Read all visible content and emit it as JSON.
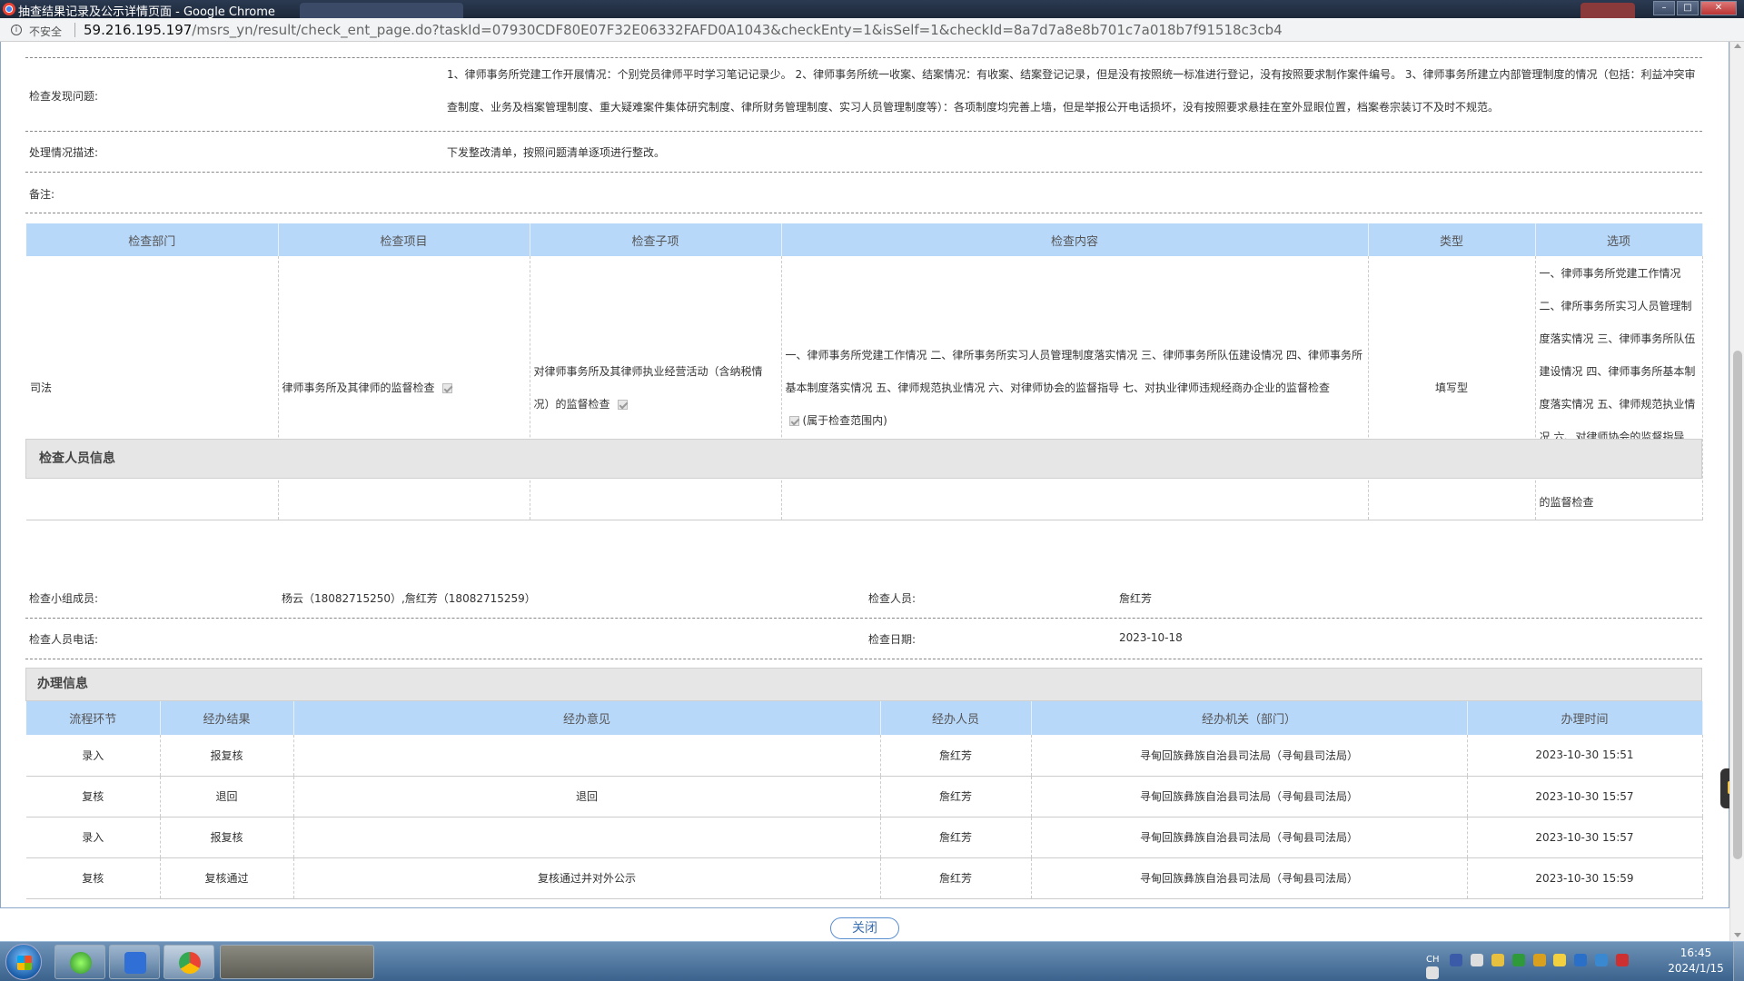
{
  "window": {
    "title": "抽查结果记录及公示详情页面 - Google Chrome"
  },
  "addressbar": {
    "security_label": "不安全",
    "url_host": "59.216.195.197",
    "url_path": "/msrs_yn/result/check_ent_page.do?taskId=07930CDF80E07F32E06332FAFD0A1043&checkEnty=1&isSelf=1&checkId=8a7d7a8e8b701c7a018b7f91518c3cb4"
  },
  "findings": {
    "label": "检查发现问题:",
    "value": "1、律师事务所党建工作开展情况：个别党员律师平时学习笔记记录少。 2、律师事务所统一收案、结案情况：有收案、结案登记记录，但是没有按照统一标准进行登记，没有按照要求制作案件编号。 3、律师事务所建立内部管理制度的情况（包括：利益冲突审查制度、业务及档案管理制度、重大疑难案件集体研究制度、律所财务管理制度、实习人员管理制度等）：各项制度均完善上墙，但是举报公开电话损坏，没有按照要求悬挂在室外显眼位置，档案卷宗装订不及时不规范。"
  },
  "handling": {
    "label": "处理情况描述:",
    "value": "下发整改清单，按照问题清单逐项进行整改。"
  },
  "remarks": {
    "label": "备注:"
  },
  "check_table": {
    "headers": [
      "检查部门",
      "检查项目",
      "检查子项",
      "检查内容",
      "类型",
      "选项"
    ],
    "row": {
      "dept": "司法",
      "item": "律师事务所及其律师的监督检查",
      "subitem": "对律师事务所及其律师执业经营活动（含纳税情况）的监督检查",
      "content": "一、律师事务所党建工作情况 二、律所事务所实习人员管理制度落实情况 三、律师事务所队伍建设情况 四、律师事务所基本制度落实情况 五、律师规范执业情况 六、对律师协会的监督指导 七、对执业律师违规经商办企业的监督检查",
      "content_suffix": "(属于检查范围内)",
      "type": "填写型",
      "options": "一、律师事务所党建工作情况 二、律所事务所实习人员管理制度落实情况 三、律师事务所队伍建设情况 四、律师事务所基本制度落实情况 五、律师规范执业情况 六、对律师协会的监督指导 七、对执业律师违规经商办企业的监督检查"
    }
  },
  "inspector_section": {
    "title": "检查人员信息",
    "team_label": "检查小组成员:",
    "team_value": "杨云（18082715250）,詹红芳（18082715259）",
    "inspector_label": "检查人员:",
    "inspector_value": "詹红芳",
    "phone_label": "检查人员电话:",
    "date_label": "检查日期:",
    "date_value": "2023-10-18"
  },
  "process_section": {
    "title": "办理信息",
    "headers": [
      "流程环节",
      "经办结果",
      "经办意见",
      "经办人员",
      "经办机关（部门）",
      "办理时间"
    ],
    "rows": [
      [
        "录入",
        "报复核",
        "",
        "詹红芳",
        "寻甸回族彝族自治县司法局（寻甸县司法局）",
        "2023-10-30 15:51"
      ],
      [
        "复核",
        "退回",
        "退回",
        "詹红芳",
        "寻甸回族彝族自治县司法局（寻甸县司法局）",
        "2023-10-30 15:57"
      ],
      [
        "录入",
        "报复核",
        "",
        "詹红芳",
        "寻甸回族彝族自治县司法局（寻甸县司法局）",
        "2023-10-30 15:57"
      ],
      [
        "复核",
        "复核通过",
        "复核通过并对外公示",
        "詹红芳",
        "寻甸回族彝族自治县司法局（寻甸县司法局）",
        "2023-10-30 15:59"
      ]
    ]
  },
  "close_button": "关闭",
  "taskbar": {
    "input_lang": "CH",
    "time": "16:45",
    "date": "2024/1/15"
  },
  "colors": {
    "table_header": "#b8d8fa",
    "section_bg": "#e6e6e6",
    "button_border": "#5b8fd0"
  }
}
